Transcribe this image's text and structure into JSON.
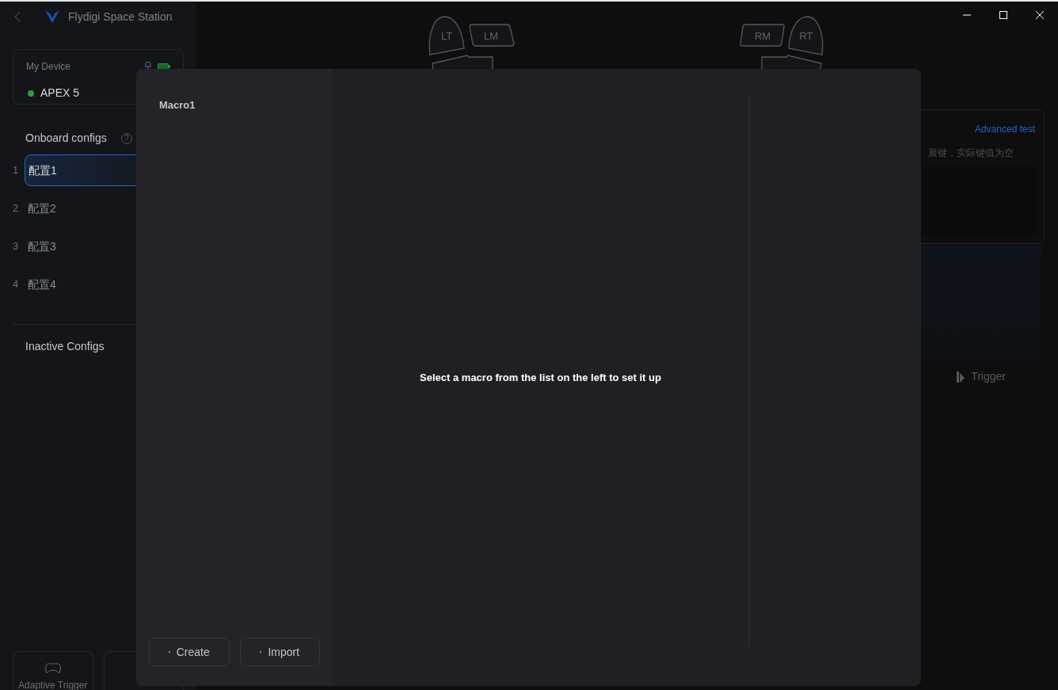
{
  "app": {
    "title": "Flydigi Space Station"
  },
  "device": {
    "label": "My Device",
    "name": "APEX 5",
    "connected": true
  },
  "onboard": {
    "label": "Onboard configs",
    "help": "?",
    "items": [
      {
        "index": "1",
        "name": "配置1",
        "selected": true
      },
      {
        "index": "2",
        "name": "配置2",
        "selected": false
      },
      {
        "index": "3",
        "name": "配置3",
        "selected": false
      },
      {
        "index": "4",
        "name": "配置4",
        "selected": false
      }
    ]
  },
  "inactive": {
    "label": "Inactive Configs"
  },
  "modes": [
    {
      "label": "Adaptive Trigger"
    }
  ],
  "shoulder_buttons": [
    {
      "label": "LT"
    },
    {
      "label": "LM"
    },
    {
      "label": "RM"
    },
    {
      "label": "RT"
    }
  ],
  "test_card": {
    "link": "Advanced test",
    "note": "展键，实际键值为空"
  },
  "trigger_tab": {
    "label": "Trigger"
  },
  "macro_dialog": {
    "macros": [
      {
        "name": "Macro1",
        "selected": false
      }
    ],
    "empty_message": "Select a macro from the list on the left to set it up",
    "buttons": [
      {
        "label": "Create"
      },
      {
        "label": "Import"
      }
    ]
  }
}
